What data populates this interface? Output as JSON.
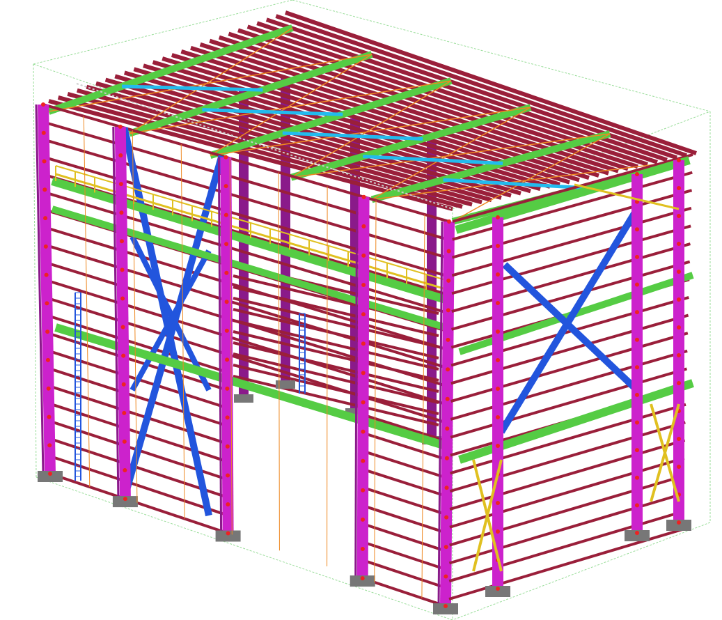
{
  "view": {
    "projection": "isometric",
    "background": "#ffffff",
    "show_bounding_box": true
  },
  "structure": {
    "type": "steel-frame-building",
    "bays_along_length": 4,
    "bays_along_width": 2,
    "has_roof_purlins": true,
    "has_gantry_walkway": true,
    "has_ladders": true,
    "has_cross_bracing": true,
    "has_base_plates": true
  },
  "colors": {
    "columns": "#cc22cc",
    "column_dark": "#8a1a8a",
    "girts": "#9a1f3a",
    "roof_beams": "#55cc44",
    "bracing": "#2255dd",
    "bracing_light": "#22bbee",
    "walkway_rail": "#e0c020",
    "sag_rods": "#ee8822",
    "base_plates": "#777777",
    "bounding_box": "#99dd99",
    "connections": "#ee2222"
  }
}
